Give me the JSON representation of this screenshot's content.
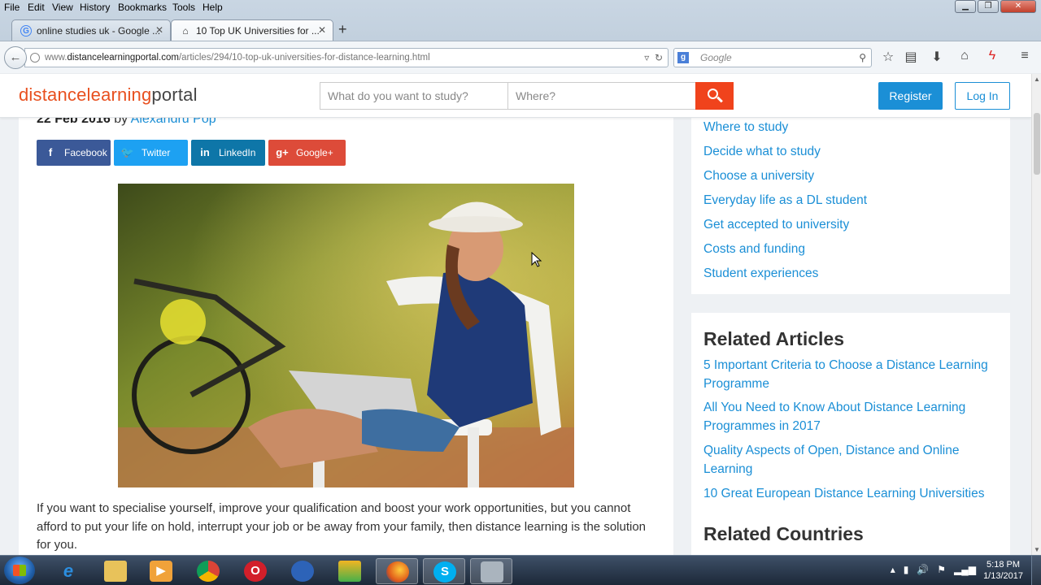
{
  "browser": {
    "menu": [
      "File",
      "Edit",
      "View",
      "History",
      "Bookmarks",
      "Tools",
      "Help"
    ],
    "tabs": [
      {
        "title": "online studies uk - Google ...",
        "icon": "google-icon"
      },
      {
        "title": "10 Top UK Universities for ...",
        "icon": "dlp-icon"
      }
    ],
    "url_prefix": "www.",
    "url_domain": "distancelearningportal.com",
    "url_path": "/articles/294/10-top-uk-universities-for-distance-learning.html",
    "search_placeholder": "Google"
  },
  "site": {
    "logo_part1": "distancelearning",
    "logo_part2": "portal",
    "study_placeholder": "What do you want to study?",
    "where_placeholder": "Where?",
    "register": "Register",
    "login": "Log In",
    "accent": "#e8501f",
    "link_color": "#1b8fd6"
  },
  "article": {
    "date": "22 Feb 2016",
    "by": "by",
    "author": "Alexandru Pop",
    "share": [
      {
        "label": "Facebook",
        "icon": "facebook-icon",
        "color": "#3b5998"
      },
      {
        "label": "Twitter",
        "icon": "twitter-icon",
        "color": "#1da1f2"
      },
      {
        "label": "LinkedIn",
        "icon": "linkedin-icon",
        "color": "#0e76a8"
      },
      {
        "label": "Google+",
        "icon": "google-plus-icon",
        "color": "#dd4b39"
      }
    ],
    "paragraph": "If you want to specialise yourself, improve your qualification and boost your work opportunities, but you cannot afford to put your life on hold, interrupt your job or be away from your family, then distance learning is the solution for you."
  },
  "sidebar": {
    "links": [
      "Where to study",
      "Decide what to study",
      "Choose a university",
      "Everyday life as a DL student",
      "Get accepted to university",
      "Costs and funding",
      "Student experiences"
    ],
    "related_title": "Related Articles",
    "related": [
      "5 Important Criteria to Choose a Distance Learning Programme",
      "All You Need to Know About Distance Learning Programmes in 2017",
      "Quality Aspects of Open, Distance and Online Learning",
      "10 Great European Distance Learning Universities"
    ],
    "countries_title": "Related Countries"
  },
  "taskbar": {
    "time": "5:18 PM",
    "date": "1/13/2017"
  }
}
